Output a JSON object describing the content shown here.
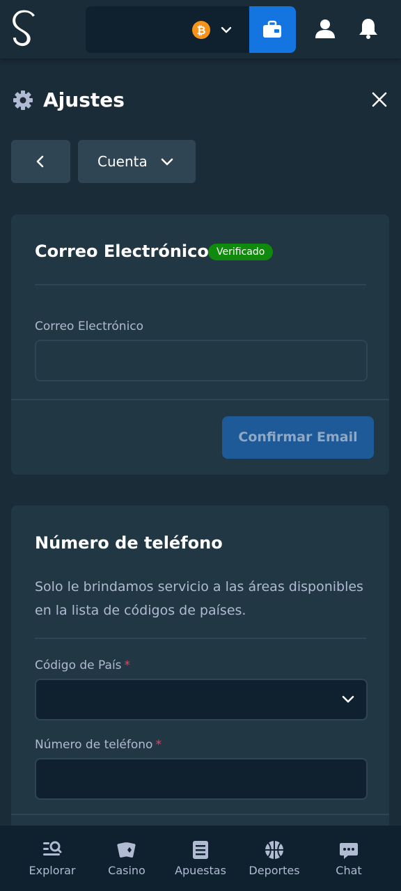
{
  "header": {
    "logo_icon": "stake-logo-icon",
    "currency_icon": "bitcoin-icon",
    "wallet_icon": "wallet-icon",
    "user_icon": "user-icon",
    "bell_icon": "bell-icon",
    "accent": "#1475e1"
  },
  "settings": {
    "title": "Ajustes",
    "section": "Cuenta"
  },
  "email_card": {
    "title": "Correo Electrónico",
    "badge": "Verificado",
    "field_label": "Correo Electrónico",
    "field_value": "",
    "confirm_label": "Confirmar Email"
  },
  "phone_card": {
    "title": "Número de teléfono",
    "description": "Solo le brindamos servicio a las áreas disponibles en la lista de códigos de países.",
    "country_label": "Código de País",
    "country_value": "",
    "phone_label": "Número de teléfono",
    "phone_value": "",
    "required_mark": "*"
  },
  "bottom_nav": {
    "items": [
      {
        "label": "Explorar",
        "icon": "explore-icon"
      },
      {
        "label": "Casino",
        "icon": "casino-cards-icon"
      },
      {
        "label": "Apuestas",
        "icon": "bets-list-icon"
      },
      {
        "label": "Deportes",
        "icon": "basketball-icon"
      },
      {
        "label": "Chat",
        "icon": "chat-icon"
      }
    ]
  }
}
